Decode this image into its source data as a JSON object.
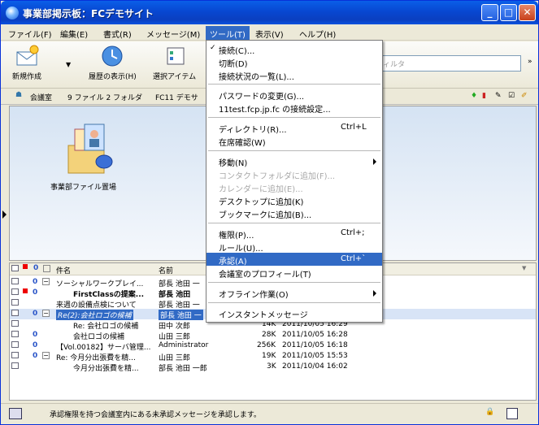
{
  "window": {
    "title": "事業部掲示板：FCデモサイト"
  },
  "menubar": [
    "ファイル(F)",
    "編集(E)",
    "書式(R)",
    "メッセージ(M)",
    "ツール(T)",
    "表示(V)",
    "ヘルプ(H)"
  ],
  "toolbar": {
    "new_label": "新規作成",
    "history_label": "履歴の表示(H)",
    "select_label": "選択アイテム",
    "search_placeholder": "ィルタ"
  },
  "pathbar": {
    "room": "会議室",
    "counts": "9 ファイル 2 フォルダ",
    "path": "FC11 デモサ"
  },
  "upper": {
    "folder_label": "事業部ファイル置場"
  },
  "list": {
    "headers": [
      "件名",
      "名前"
    ],
    "rows": [
      {
        "subject": "ソーシャルワークプレイ...",
        "from": "部長 池田 一",
        "size": "",
        "date": ""
      },
      {
        "subject": "FirstClassの提案...",
        "from": "部長 池田",
        "size": "",
        "date": ""
      },
      {
        "subject": "来週の設備点検について",
        "from": "部長 池田 一",
        "size": "",
        "date": ""
      },
      {
        "subject": "Re(2):会社ロゴの候補",
        "from": "部長 池田 一",
        "size": "",
        "date": ""
      },
      {
        "subject": "Re: 会社ロゴの候補",
        "from": "田中 次郎",
        "size": "14K",
        "date": "2011/10/05 16:29"
      },
      {
        "subject": "会社ロゴの候補",
        "from": "山田 三郎",
        "size": "28K",
        "date": "2011/10/05 16:28"
      },
      {
        "subject": "【Vol.00182】サーバ管理...",
        "from": "Administrator",
        "size": "256K",
        "date": "2011/10/05 16:18"
      },
      {
        "subject": "Re: 今月分出張費を精...",
        "from": "山田 三郎",
        "size": "19K",
        "date": "2011/10/05 15:53"
      },
      {
        "subject": "今月分出張費を精...",
        "from": "部長 池田 一郎",
        "size": "3K",
        "date": "2011/10/04 16:02"
      }
    ]
  },
  "status": {
    "text": "承認権限を持つ会議室内にある未承認メッセージを承認します。"
  },
  "dropdown": {
    "items": [
      {
        "label": "接続(C)...",
        "shortcut": ""
      },
      {
        "label": "切断(D)",
        "shortcut": ""
      },
      {
        "label": "接続状況の一覧(L)...",
        "shortcut": ""
      },
      {
        "label": "パスワードの変更(G)...",
        "shortcut": ""
      },
      {
        "label": "11test.fcp.jp.fc の接続設定...",
        "shortcut": ""
      },
      {
        "label": "ディレクトリ(R)...",
        "shortcut": "Ctrl+L"
      },
      {
        "label": "在席確認(W)",
        "shortcut": ""
      },
      {
        "label": "移動(N)",
        "shortcut": ""
      },
      {
        "label": "コンタクトフォルダに追加(F)...",
        "shortcut": ""
      },
      {
        "label": "カレンダーに追加(E)...",
        "shortcut": ""
      },
      {
        "label": "デスクトップに追加(K)",
        "shortcut": ""
      },
      {
        "label": "ブックマークに追加(B)...",
        "shortcut": ""
      },
      {
        "label": "権限(P)...",
        "shortcut": "Ctrl+;"
      },
      {
        "label": "ルール(U)...",
        "shortcut": ""
      },
      {
        "label": "承認(A)",
        "shortcut": "Ctrl+`"
      },
      {
        "label": "会議室のプロフィール(T)",
        "shortcut": ""
      },
      {
        "label": "オフライン作業(O)",
        "shortcut": ""
      },
      {
        "label": "インスタントメッセージ",
        "shortcut": ""
      }
    ]
  }
}
